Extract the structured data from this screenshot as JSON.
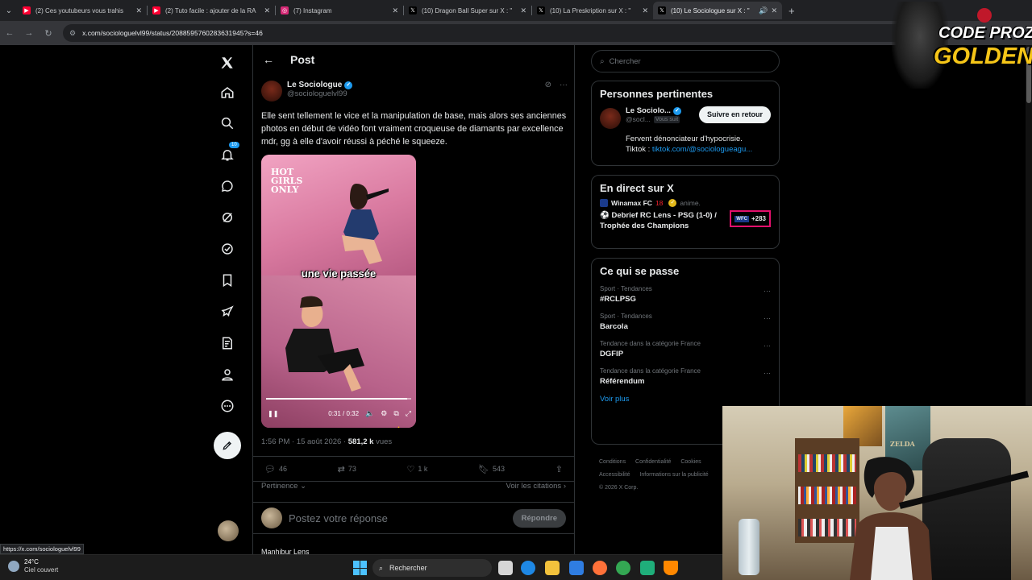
{
  "browser": {
    "tabs": [
      {
        "title": "(2) Ces youtubeurs vous trahis",
        "favicon": "youtube-icon",
        "color": "#ff0033",
        "active": false
      },
      {
        "title": "(2) Tuto facile : ajouter de la RA",
        "favicon": "youtube-icon",
        "color": "#ff0033",
        "active": false
      },
      {
        "title": "(7) Instagram",
        "favicon": "instagram-icon",
        "color": "#d62976",
        "active": false
      },
      {
        "title": "(10) Dragon Ball Super sur X : \"",
        "favicon": "x-icon",
        "color": "#000000",
        "active": false
      },
      {
        "title": "(10) La Preskription sur X : \"",
        "favicon": "x-icon",
        "color": "#000000",
        "active": false
      },
      {
        "title": "(10) Le Sociologue sur X : \"",
        "favicon": "x-icon",
        "color": "#000000",
        "active": true
      }
    ],
    "url": "x.com/sociologuelvl99/status/2088595760283631945?s=46",
    "status_url": "https://x.com/sociologuelvl99"
  },
  "nav": {
    "notifications_badge": "10",
    "icons": [
      "x-logo-icon",
      "home-icon",
      "search-icon",
      "notifications-icon",
      "messages-icon",
      "grok-icon",
      "premium-icon",
      "bookmarks-icon",
      "business-icon",
      "articles-icon",
      "profile-icon",
      "more-icon"
    ]
  },
  "post": {
    "header_title": "Post",
    "author_name": "Le Sociologue",
    "author_handle": "@sociologuelvl99",
    "text": "Elle sent tellement le vice et la manipulation de base, mais alors ses anciennes photos en début de vidéo font vraiment croqueuse de diamants par excellence mdr, gg à elle d'avoir réussi à péché le squeeze.",
    "video": {
      "overlay_logo": "HOT GIRLS ONLY",
      "caption": "une vie passée",
      "time": "0:31 / 0:32",
      "progress": 0.97
    },
    "time": "1:56 PM · 15 août 2026 ·",
    "views_count": "581,2 k",
    "views_label": "vues",
    "replies": "46",
    "reposts": "73",
    "likes": "1 k",
    "bookmarks": "543",
    "sort_label": "Pertinence",
    "quotes_label": "Voir les citations",
    "reply_placeholder": "Postez votre réponse",
    "reply_button": "Répondre",
    "next_reply_author": "Manhibur Lens"
  },
  "sidebar": {
    "search_placeholder": "Chercher",
    "relevant": {
      "title": "Personnes pertinentes",
      "name": "Le Sociolo...",
      "handle": "@socl...",
      "follows_you": "Vous suit",
      "follow_button": "Suivre en retour",
      "bio": "Fervent dénonciateur d'hypocrisie.",
      "bio_prefix": "Tiktok : ",
      "bio_link": "tiktok.com/@sociologueagu..."
    },
    "live": {
      "title": "En direct sur X",
      "source": "Winamax FC",
      "rating": "18",
      "source_handle": "anime.",
      "event": "Debrief RC Lens - PSG (1-0) / Trophée des Champions",
      "viewers": "+283",
      "badge_logo": "WFC"
    },
    "trends": {
      "title": "Ce qui se passe",
      "items": [
        {
          "category": "Sport · Tendances",
          "topic": "#RCLPSG"
        },
        {
          "category": "Sport · Tendances",
          "topic": "Barcola"
        },
        {
          "category": "Tendance dans la catégorie France",
          "topic": "DGFIP"
        },
        {
          "category": "Tendance dans la catégorie France",
          "topic": "Référendum"
        }
      ],
      "see_more": "Voir plus"
    },
    "footer": [
      "Conditions",
      "Confidentialité",
      "Cookies",
      "Accessibilité",
      "Informations sur la publicité",
      "© 2026 X Corp."
    ]
  },
  "overlay": {
    "logo_line1": "CODE PROZIS",
    "logo_line2": "GOLDENG",
    "webcam_poster_text": "ZELDA"
  },
  "taskbar": {
    "temperature": "24°C",
    "weather": "Ciel couvert",
    "search_placeholder": "Rechercher"
  }
}
